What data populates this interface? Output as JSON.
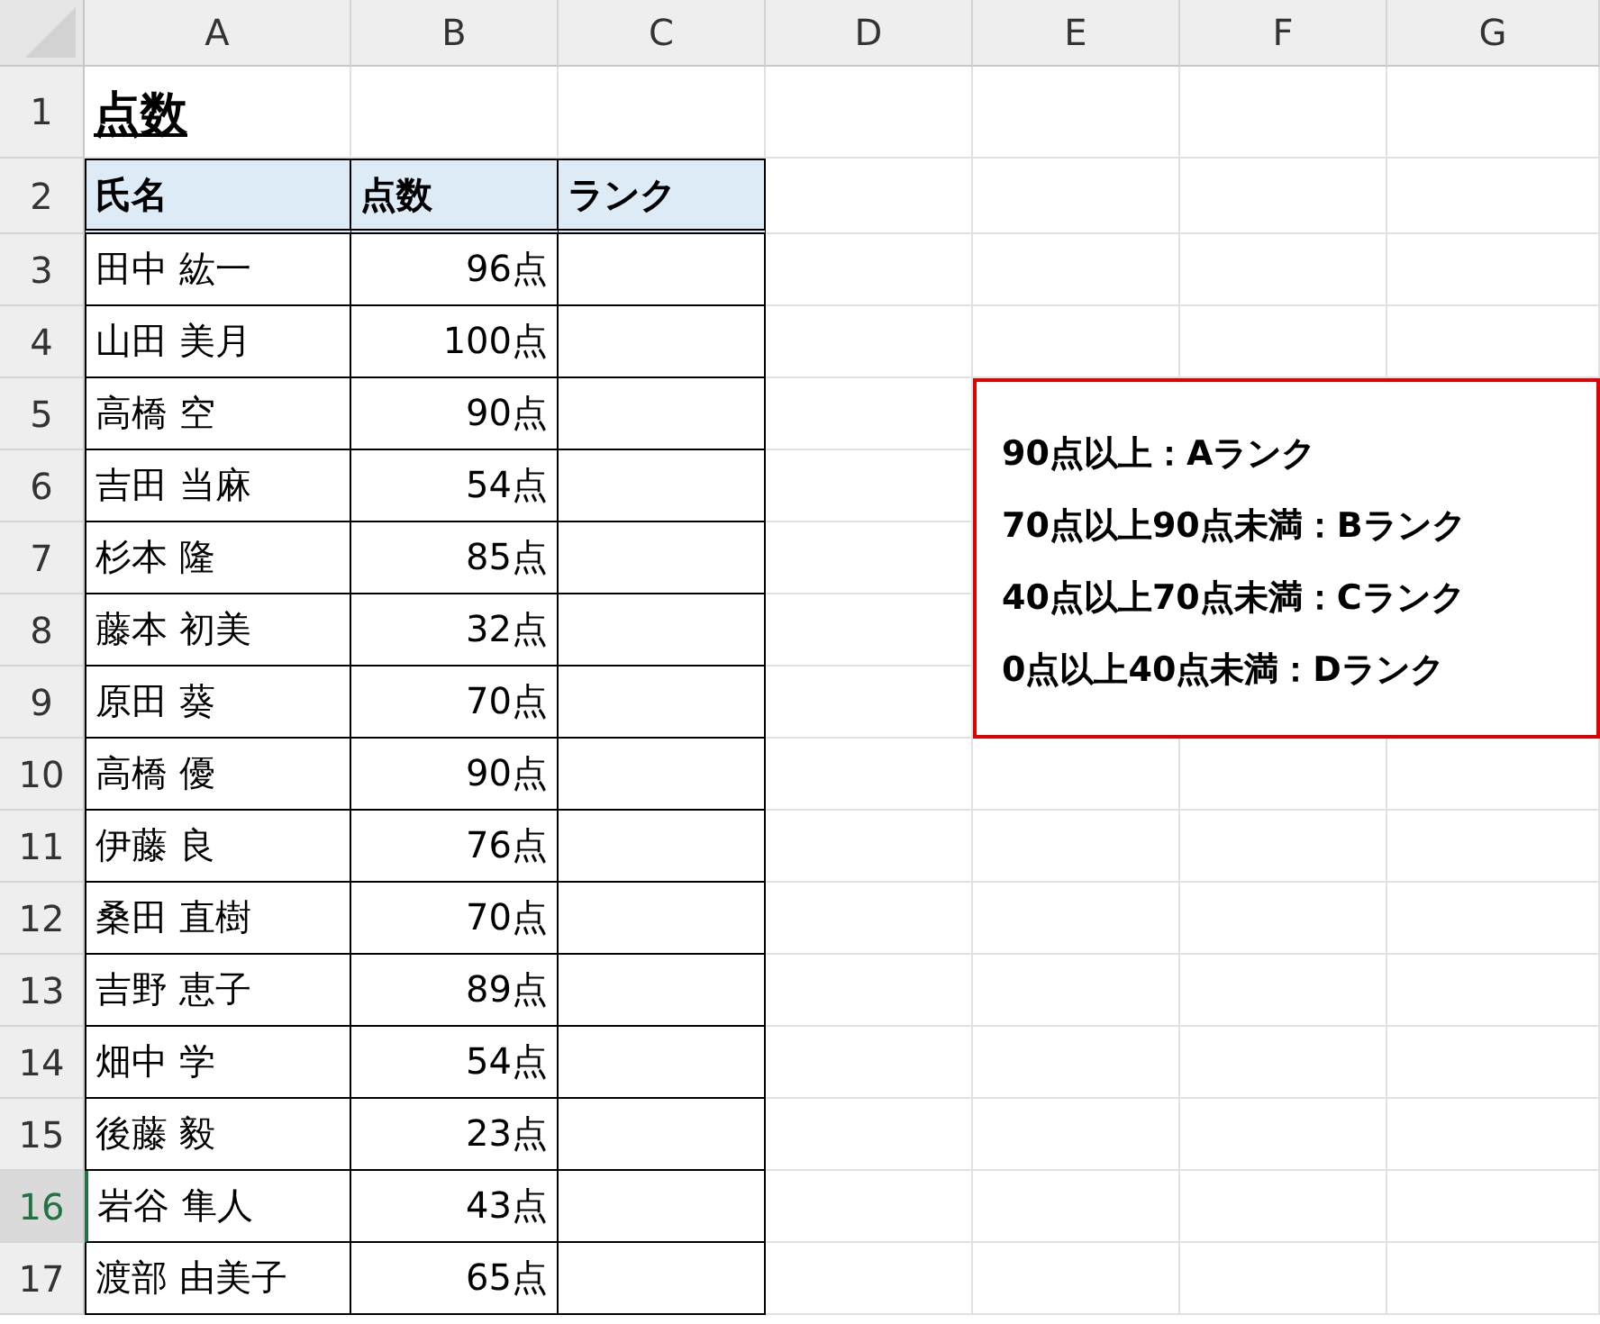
{
  "column_headers": [
    "A",
    "B",
    "C",
    "D",
    "E",
    "F",
    "G"
  ],
  "row_headers": [
    {
      "label": "1",
      "selected": false
    },
    {
      "label": "2",
      "selected": false
    },
    {
      "label": "3",
      "selected": false
    },
    {
      "label": "4",
      "selected": false
    },
    {
      "label": "5",
      "selected": false
    },
    {
      "label": "6",
      "selected": false
    },
    {
      "label": "7",
      "selected": false
    },
    {
      "label": "8",
      "selected": false
    },
    {
      "label": "9",
      "selected": false
    },
    {
      "label": "10",
      "selected": false
    },
    {
      "label": "11",
      "selected": false
    },
    {
      "label": "12",
      "selected": false
    },
    {
      "label": "13",
      "selected": false
    },
    {
      "label": "14",
      "selected": false
    },
    {
      "label": "15",
      "selected": false
    },
    {
      "label": "16",
      "selected": true
    },
    {
      "label": "17",
      "selected": false
    }
  ],
  "title": "点数",
  "table": {
    "columns": [
      "氏名",
      "点数",
      "ランク"
    ],
    "rows": [
      {
        "name": "田中 紘一",
        "score": "96点"
      },
      {
        "name": "山田 美月",
        "score": "100点"
      },
      {
        "name": "高橋 空",
        "score": "90点"
      },
      {
        "name": "吉田 当麻",
        "score": "54点"
      },
      {
        "name": "杉本 隆",
        "score": "85点"
      },
      {
        "name": "藤本 初美",
        "score": "32点"
      },
      {
        "name": "原田 葵",
        "score": "70点"
      },
      {
        "name": "高橋 優",
        "score": "90点"
      },
      {
        "name": "伊藤 良",
        "score": "76点"
      },
      {
        "name": "桑田 直樹",
        "score": "70点"
      },
      {
        "name": "吉野 恵子",
        "score": "89点"
      },
      {
        "name": "畑中 学",
        "score": "54点"
      },
      {
        "name": "後藤 毅",
        "score": "23点"
      },
      {
        "name": "岩谷 隼人",
        "score": "43点"
      },
      {
        "name": "渡部 由美子",
        "score": "65点"
      }
    ]
  },
  "note_box": {
    "lines": [
      "90点以上：Aランク",
      "70点以上90点未満：Bランク",
      "40点以上70点未満：Cランク",
      "0点以上40点未満：Dランク"
    ]
  }
}
